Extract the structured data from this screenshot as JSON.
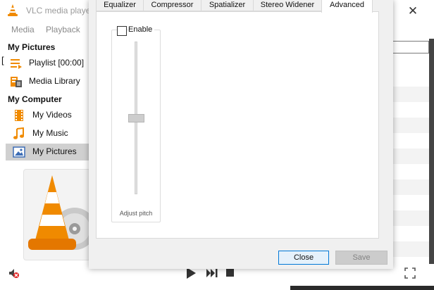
{
  "main_window": {
    "title": "VLC media playe",
    "close_glyph": "✕",
    "menu": [
      "Media",
      "Playback"
    ],
    "left_bracket": "[",
    "sidebar": {
      "sections": [
        {
          "heading": "My Pictures",
          "items": [
            {
              "label": "Playlist [00:00]",
              "icon": "playlist-icon",
              "selected": false
            },
            {
              "label": "Media Library",
              "icon": "media-library-icon",
              "selected": false
            }
          ]
        },
        {
          "heading": "My Computer",
          "items": [
            {
              "label": "My Videos",
              "icon": "film-icon",
              "selected": false
            },
            {
              "label": "My Music",
              "icon": "music-note-icon",
              "selected": false
            },
            {
              "label": "My Pictures",
              "icon": "picture-icon",
              "selected": true
            }
          ]
        }
      ]
    },
    "controls": [
      "mute-icon",
      "play-icon",
      "next-icon",
      "stop-icon",
      "fullscreen-icon"
    ]
  },
  "effects_dialog": {
    "tabs": [
      {
        "label": "Equalizer",
        "active": false
      },
      {
        "label": "Compressor",
        "active": false
      },
      {
        "label": "Spatializer",
        "active": false
      },
      {
        "label": "Stereo Widener",
        "active": false
      },
      {
        "label": "Advanced",
        "active": true
      }
    ],
    "pitch": {
      "enable_label": "Enable",
      "enabled": false,
      "slider_label": "Adjust pitch",
      "slider_position": 0.5
    },
    "buttons": {
      "close": "Close",
      "save": "Save"
    }
  },
  "colors": {
    "vlc_orange": "#f08a00",
    "selected_bg": "#d0d0d0",
    "focus_blue": "#0078d7",
    "dialog_bg": "#f0f0f0"
  }
}
